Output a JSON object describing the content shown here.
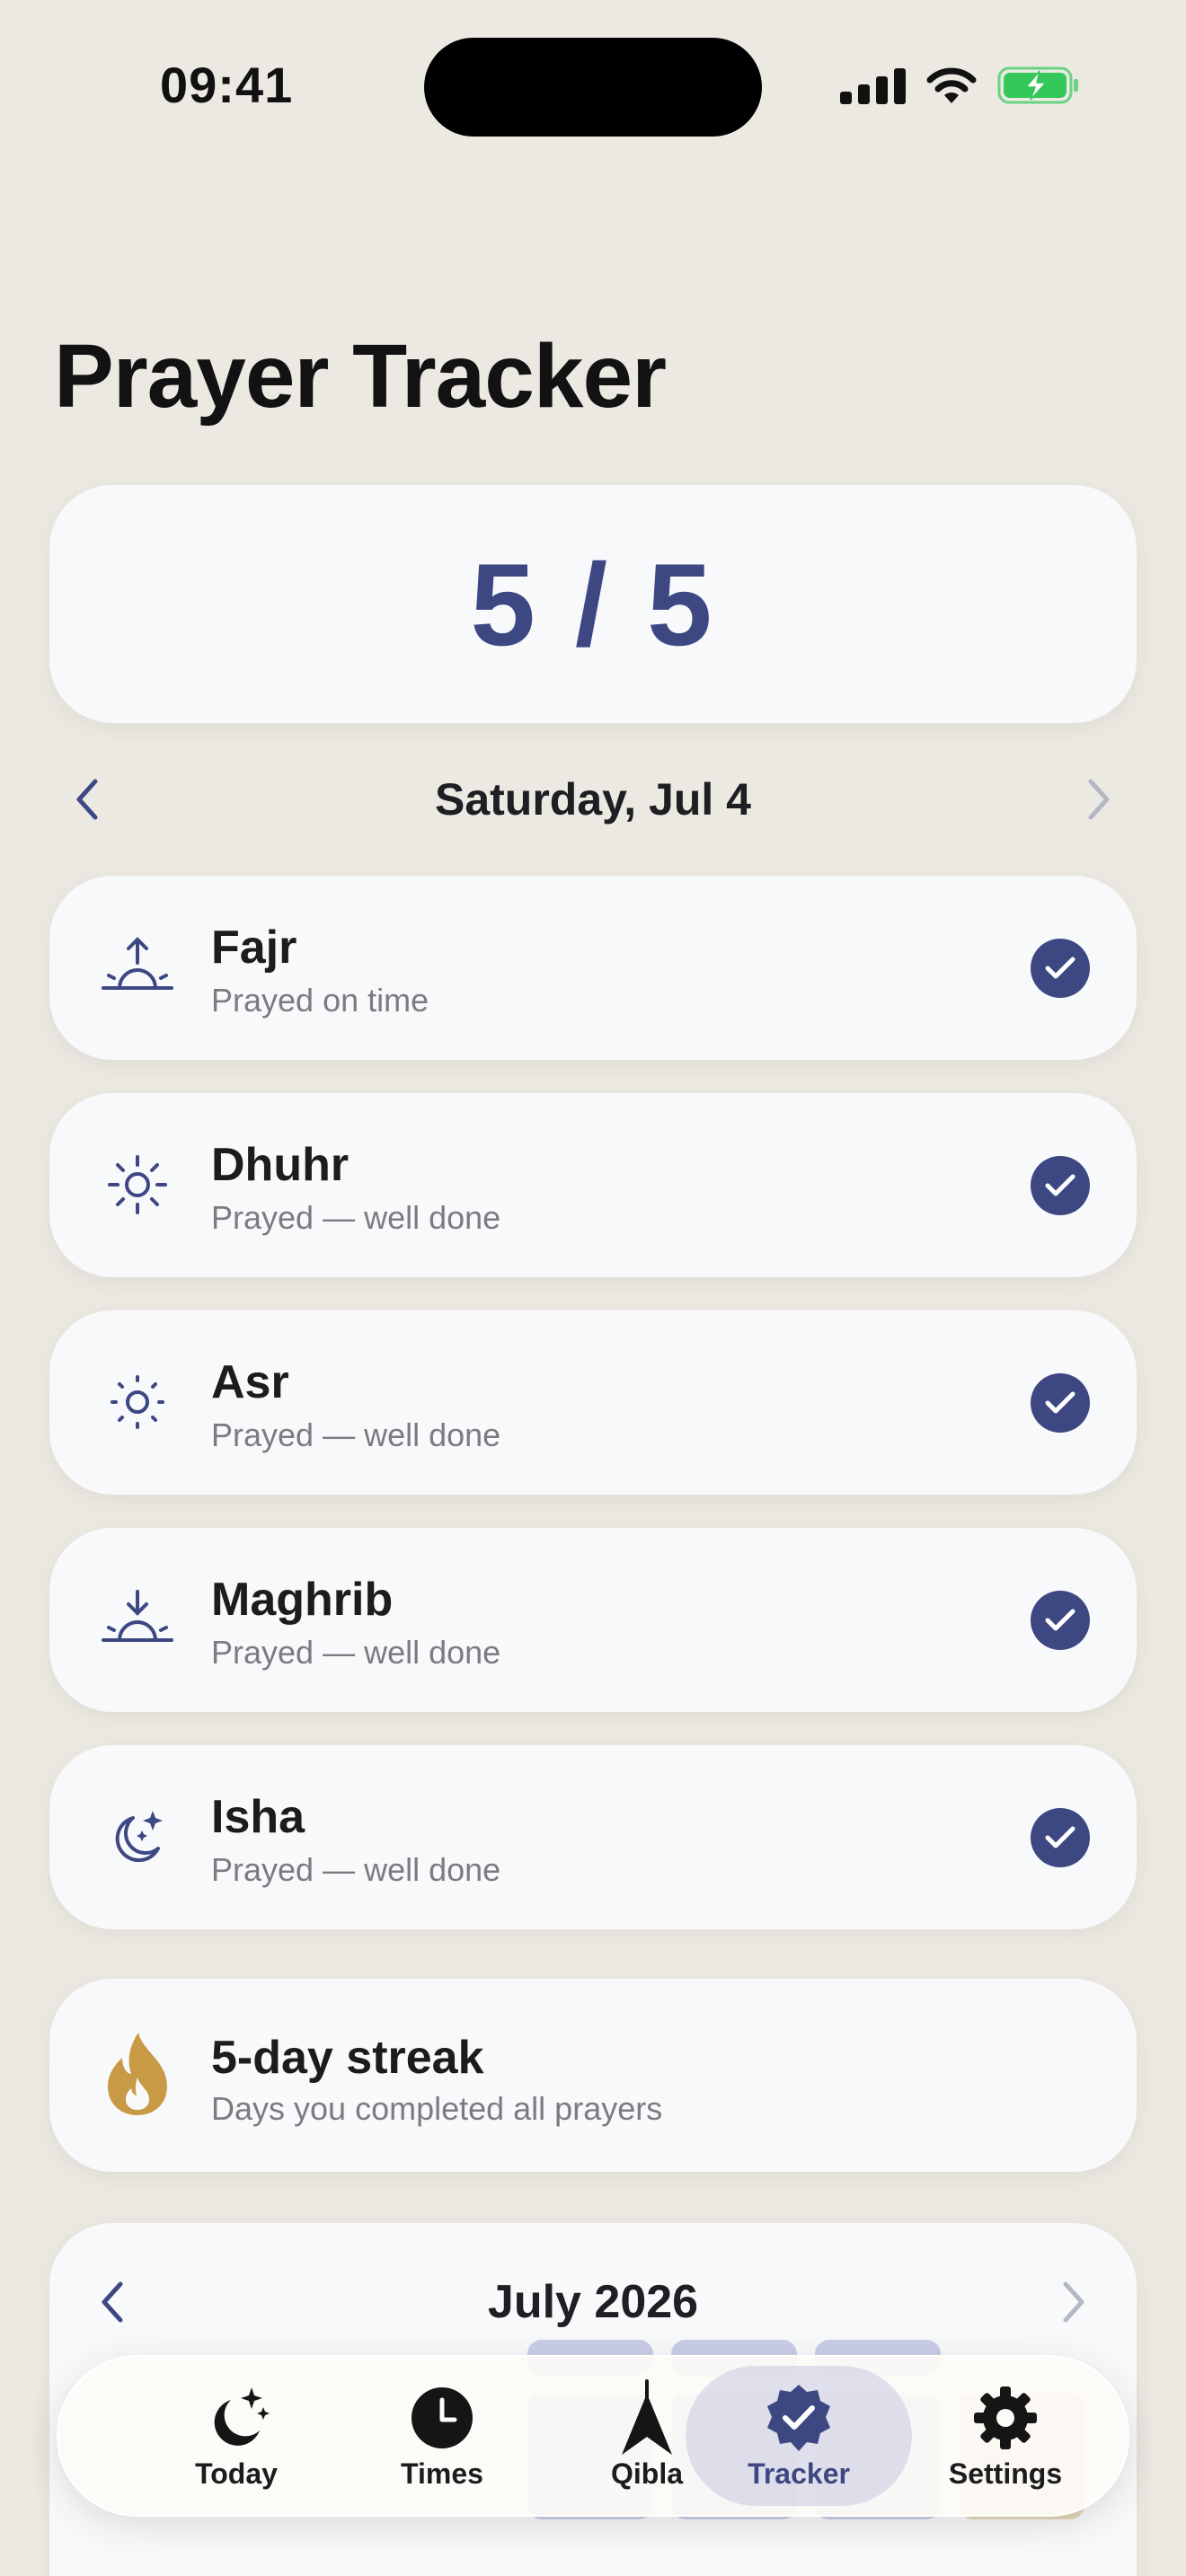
{
  "status_bar": {
    "time": "09:41"
  },
  "header": {
    "title": "Prayer Tracker"
  },
  "score": {
    "text": "5 / 5"
  },
  "date_nav": {
    "label": "Saturday, Jul 4"
  },
  "prayers": [
    {
      "name": "Fajr",
      "status": "Prayed on time",
      "icon": "sunrise-icon",
      "checked": true
    },
    {
      "name": "Dhuhr",
      "status": "Prayed — well done",
      "icon": "sun-icon",
      "checked": true
    },
    {
      "name": "Asr",
      "status": "Prayed — well done",
      "icon": "sun-small-icon",
      "checked": true
    },
    {
      "name": "Maghrib",
      "status": "Prayed — well done",
      "icon": "sunset-icon",
      "checked": true
    },
    {
      "name": "Isha",
      "status": "Prayed — well done",
      "icon": "moon-stars-icon",
      "checked": true
    }
  ],
  "streak": {
    "title": "5-day streak",
    "subtitle": "Days you completed all prayers",
    "icon": "flame-icon"
  },
  "calendar": {
    "month_label": "July 2026"
  },
  "tab_bar": {
    "active": "Tracker",
    "tabs": [
      {
        "label": "Today",
        "icon": "moon-stars-icon"
      },
      {
        "label": "Times",
        "icon": "clock-icon"
      },
      {
        "label": "Qibla",
        "icon": "compass-arrow-icon"
      },
      {
        "label": "Tracker",
        "icon": "checkmark-seal-icon"
      },
      {
        "label": "Settings",
        "icon": "gear-icon"
      }
    ]
  },
  "colors": {
    "accent": "#3D4883",
    "background": "#ECE9E3",
    "card": "#F8F9FB",
    "streak_flame": "#C99A45",
    "battery": "#34C759"
  }
}
